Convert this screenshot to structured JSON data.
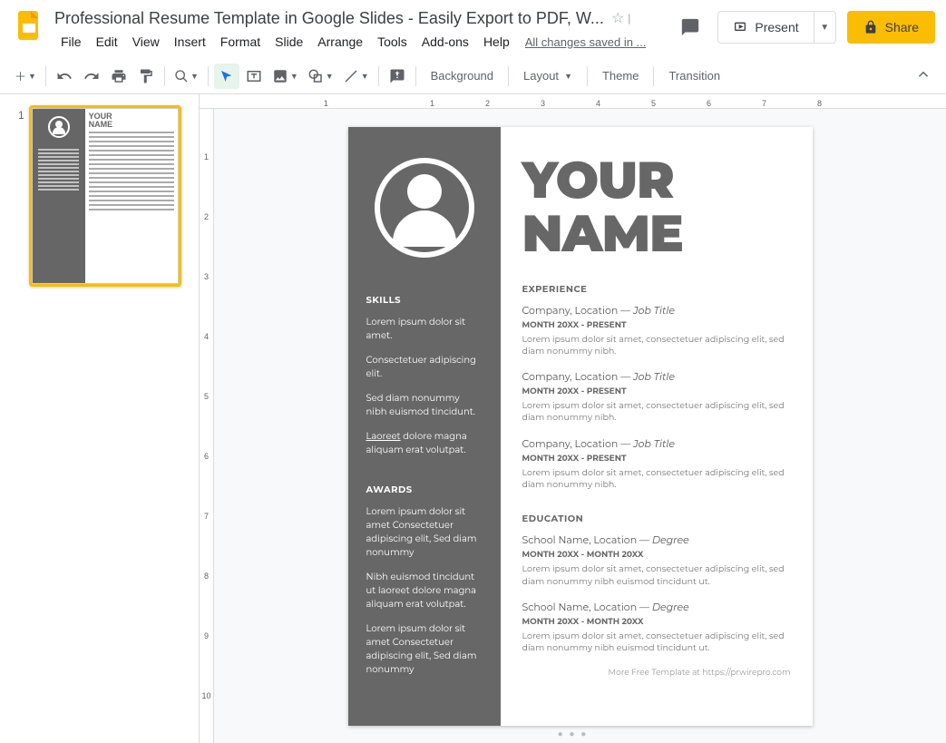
{
  "doc": {
    "title": "Professional Resume Template in Google Slides - Easily Export to PDF, W...",
    "save_status": "All changes saved in ..."
  },
  "menu": {
    "file": "File",
    "edit": "Edit",
    "view": "View",
    "insert": "Insert",
    "format": "Format",
    "slide": "Slide",
    "arrange": "Arrange",
    "tools": "Tools",
    "addons": "Add-ons",
    "help": "Help"
  },
  "header_btns": {
    "present": "Present",
    "share": "Share"
  },
  "toolbar": {
    "background": "Background",
    "layout": "Layout",
    "theme": "Theme",
    "transition": "Transition"
  },
  "ruler_h": [
    "1",
    "",
    "1",
    "2",
    "3",
    "4",
    "5",
    "6",
    "7",
    "8"
  ],
  "ruler_v": [
    "1",
    "2",
    "3",
    "4",
    "5",
    "6",
    "7",
    "8",
    "9",
    "10"
  ],
  "slide": {
    "name_line1": "YOUR",
    "name_line2": "NAME",
    "skills_h": "SKILLS",
    "skills": [
      "Lorem ipsum dolor sit amet.",
      "Consectetuer adipiscing elit.",
      "Sed diam nonummy nibh euismod tincidunt.",
      "Laoreet dolore magna aliquam erat volutpat."
    ],
    "awards_h": "AWARDS",
    "awards": [
      "Lorem ipsum dolor sit amet Consectetuer adipiscing elit, Sed diam nonummy",
      "Nibh euismod tincidunt ut laoreet dolore magna aliquam erat volutpat.",
      "Lorem ipsum dolor sit amet Consectetuer adipiscing elit, Sed diam nonummy"
    ],
    "exp_h": "EXPERIENCE",
    "jobs": [
      {
        "co": "Company, Location — ",
        "jt": "Job Title",
        "date": "MONTH 20XX - PRESENT",
        "body": "Lorem ipsum dolor sit amet, consectetuer adipiscing elit, sed diam nonummy nibh."
      },
      {
        "co": "Company, Location — ",
        "jt": "Job Title",
        "date": "MONTH 20XX - PRESENT",
        "body": "Lorem ipsum dolor sit amet, consectetuer adipiscing elit, sed diam nonummy nibh."
      },
      {
        "co": "Company, Location — ",
        "jt": "Job Title",
        "date": "MONTH 20XX - PRESENT",
        "body": "Lorem ipsum dolor sit amet, consectetuer adipiscing elit, sed diam nonummy nibh."
      }
    ],
    "edu_h": "EDUCATION",
    "edu": [
      {
        "co": "School Name, Location — ",
        "jt": "Degree",
        "date": "MONTH 20XX - MONTH 20XX",
        "body": "Lorem ipsum dolor sit amet, consectetuer adipiscing elit, sed diam nonummy nibh euismod tincidunt ut."
      },
      {
        "co": "School Name, Location — ",
        "jt": "Degree",
        "date": "MONTH 20XX - MONTH 20XX",
        "body": "Lorem ipsum dolor sit amet, consectetuer adipiscing elit, sed diam nonummy nibh euismod tincidunt ut."
      }
    ],
    "footer_prefix": "More Free Template at ",
    "footer_link": "https://prwirepro.com"
  },
  "thumb_num": "1"
}
